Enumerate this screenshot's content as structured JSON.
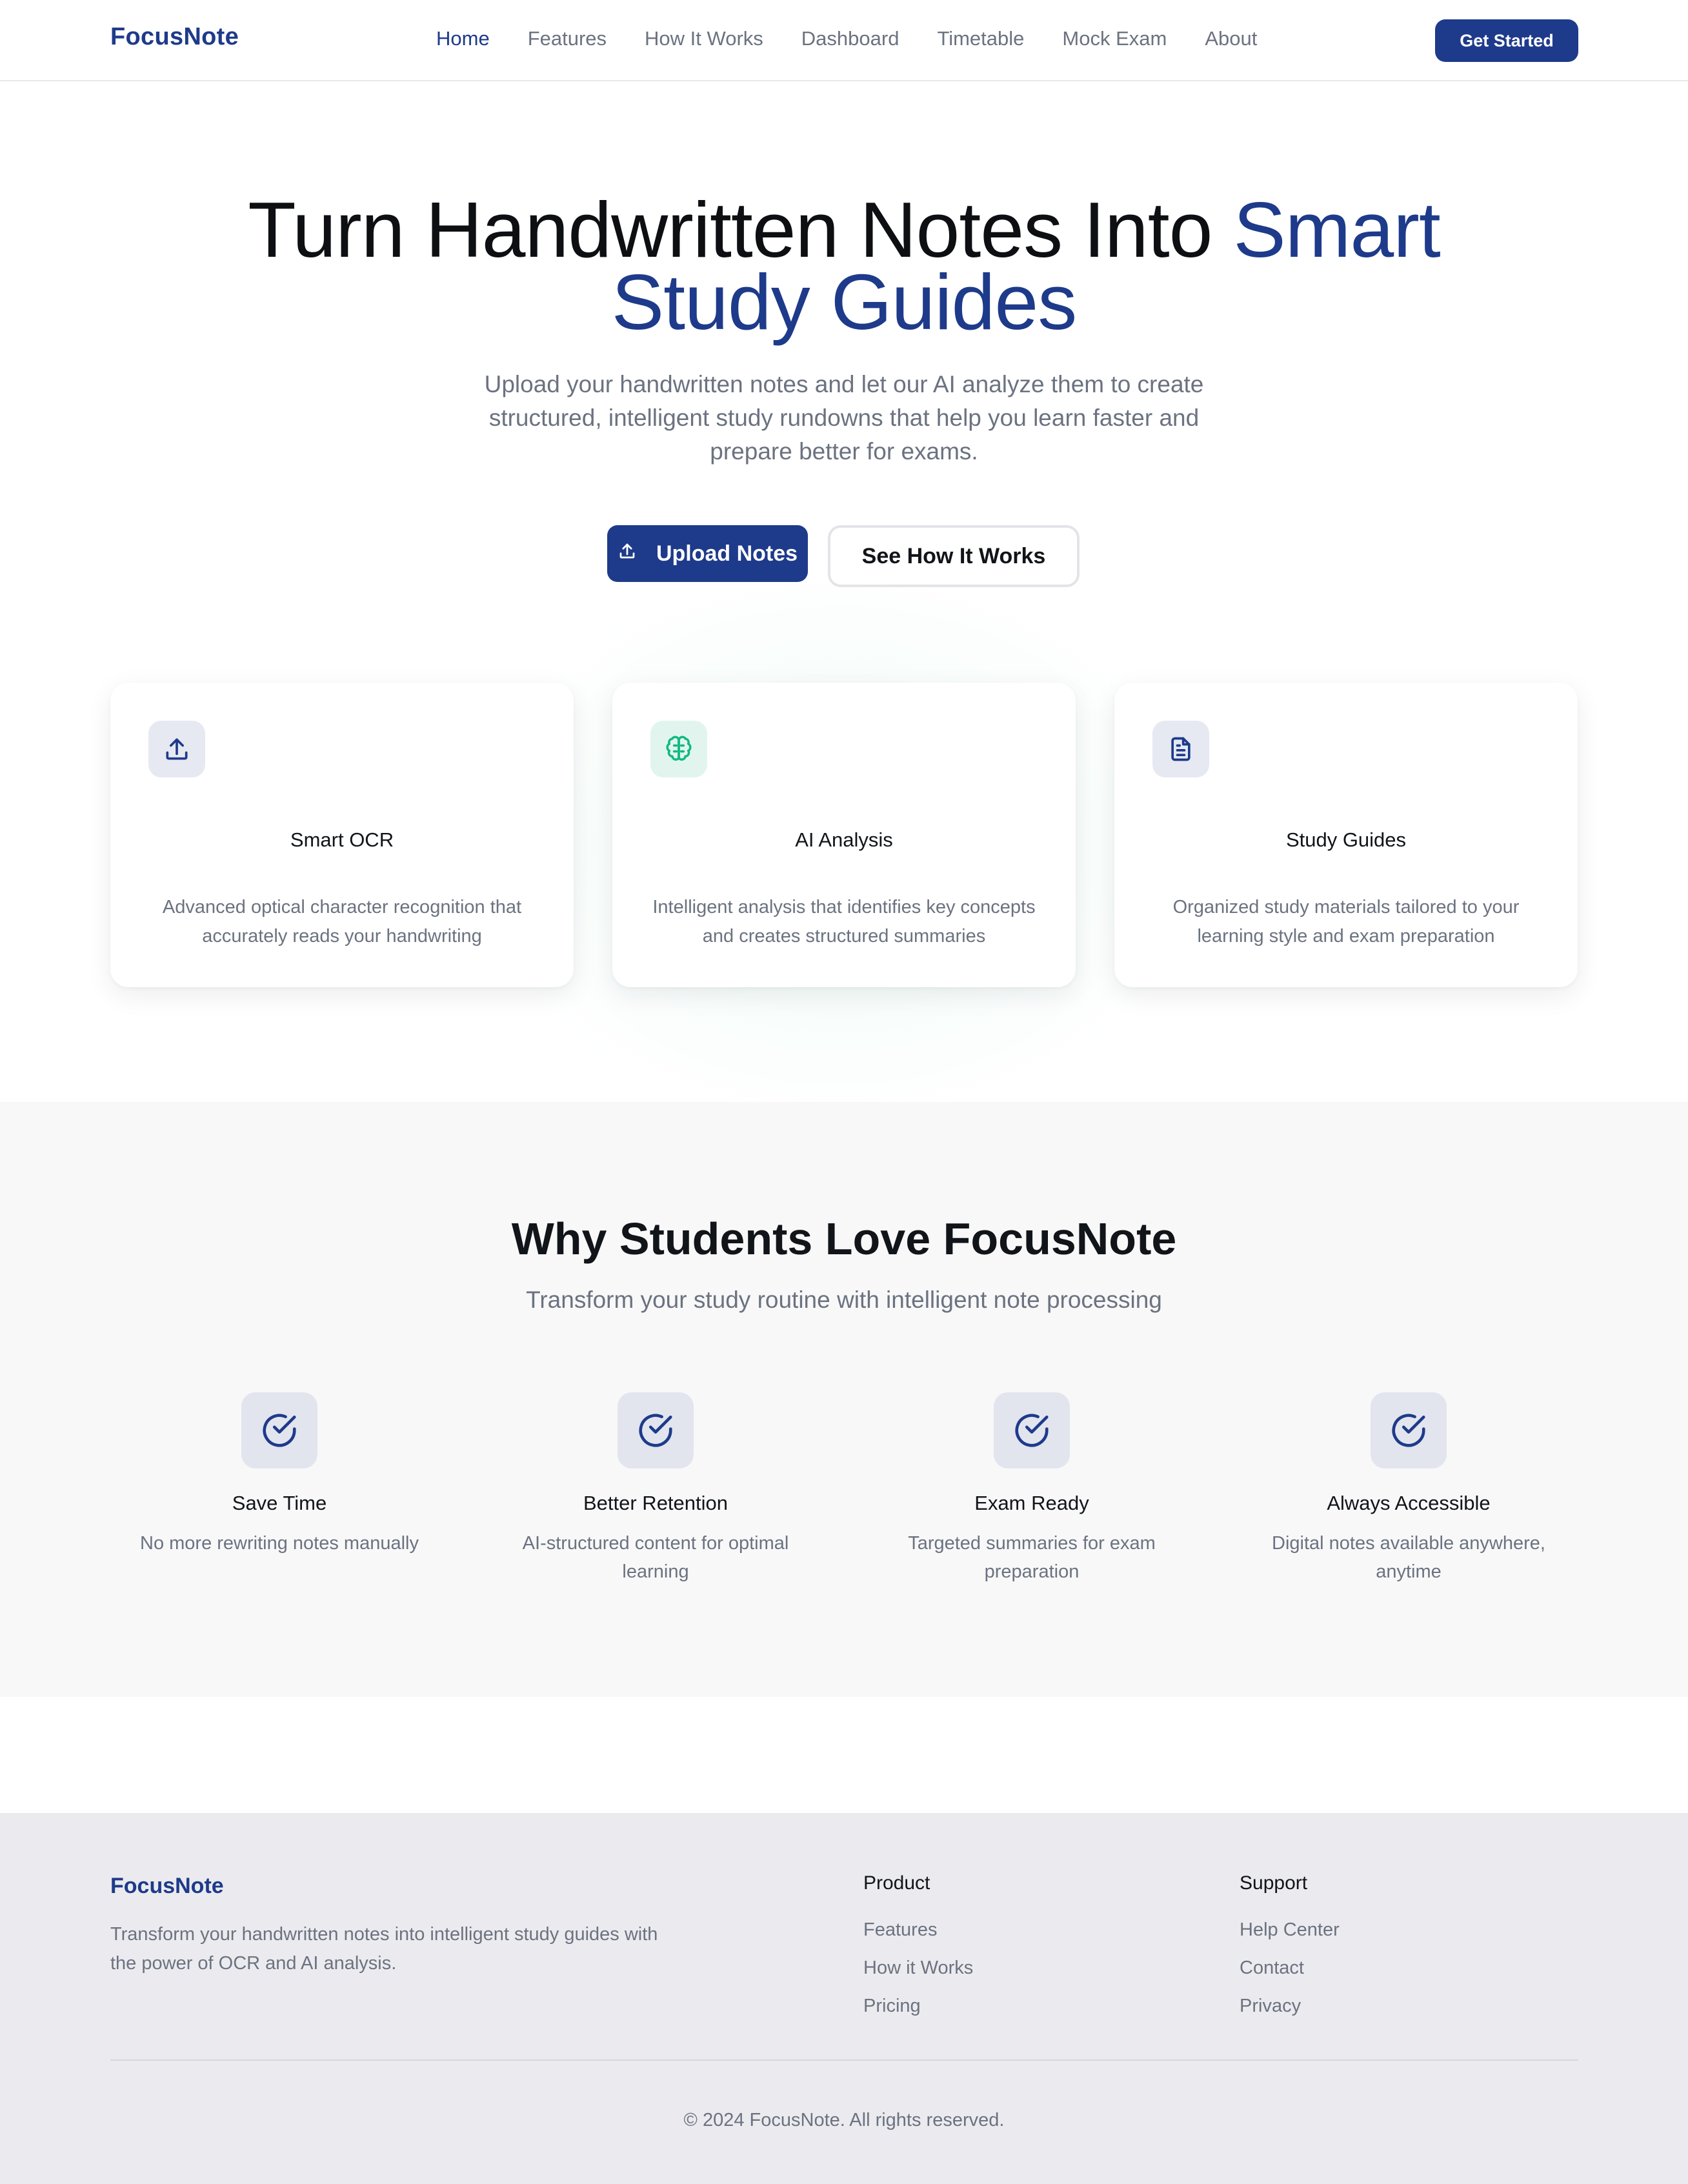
{
  "nav": {
    "logo": "FocusNote",
    "links": [
      "Home",
      "Features",
      "How It Works",
      "Dashboard",
      "Timetable",
      "Mock Exam",
      "About"
    ],
    "active": "Home",
    "cta": "Get Started"
  },
  "hero": {
    "title_plain": "Turn Handwritten Notes Into ",
    "title_accent_1": "Smart",
    "title_accent_2": "Study Guides",
    "subtitle": "Upload your handwritten notes and let our AI analyze them to create structured, intelligent study rundowns that help you learn faster and prepare better for exams.",
    "primary_button": "Upload Notes",
    "secondary_button": "See How It Works"
  },
  "features": [
    {
      "icon": "upload-icon",
      "title": "Smart OCR",
      "description": "Advanced optical character recognition that accurately reads your handwriting"
    },
    {
      "icon": "brain-icon",
      "title": "AI Analysis",
      "description": "Intelligent analysis that identifies key concepts and creates structured summaries"
    },
    {
      "icon": "document-icon",
      "title": "Study Guides",
      "description": "Organized study materials tailored to your learning style and exam preparation"
    }
  ],
  "why": {
    "title": "Why Students Love FocusNote",
    "subtitle": "Transform your study routine with intelligent note processing",
    "benefits": [
      {
        "title": "Save Time",
        "description": "No more rewriting notes manually"
      },
      {
        "title": "Better Retention",
        "description": "AI-structured content for optimal learning"
      },
      {
        "title": "Exam Ready",
        "description": "Targeted summaries for exam preparation"
      },
      {
        "title": "Always Accessible",
        "description": "Digital notes available anywhere, anytime"
      }
    ]
  },
  "footer": {
    "logo": "FocusNote",
    "about": "Transform your handwritten notes into intelligent study guides with the power of OCR and AI analysis.",
    "product": {
      "title": "Product",
      "links": [
        "Features",
        "How it Works",
        "Pricing"
      ]
    },
    "support": {
      "title": "Support",
      "links": [
        "Help Center",
        "Contact",
        "Privacy"
      ]
    },
    "copyright": "© 2024 FocusNote. All rights reserved."
  },
  "colors": {
    "brand": "#1e3a8a",
    "accent_green": "#10b981",
    "text_muted": "#6b7280"
  }
}
